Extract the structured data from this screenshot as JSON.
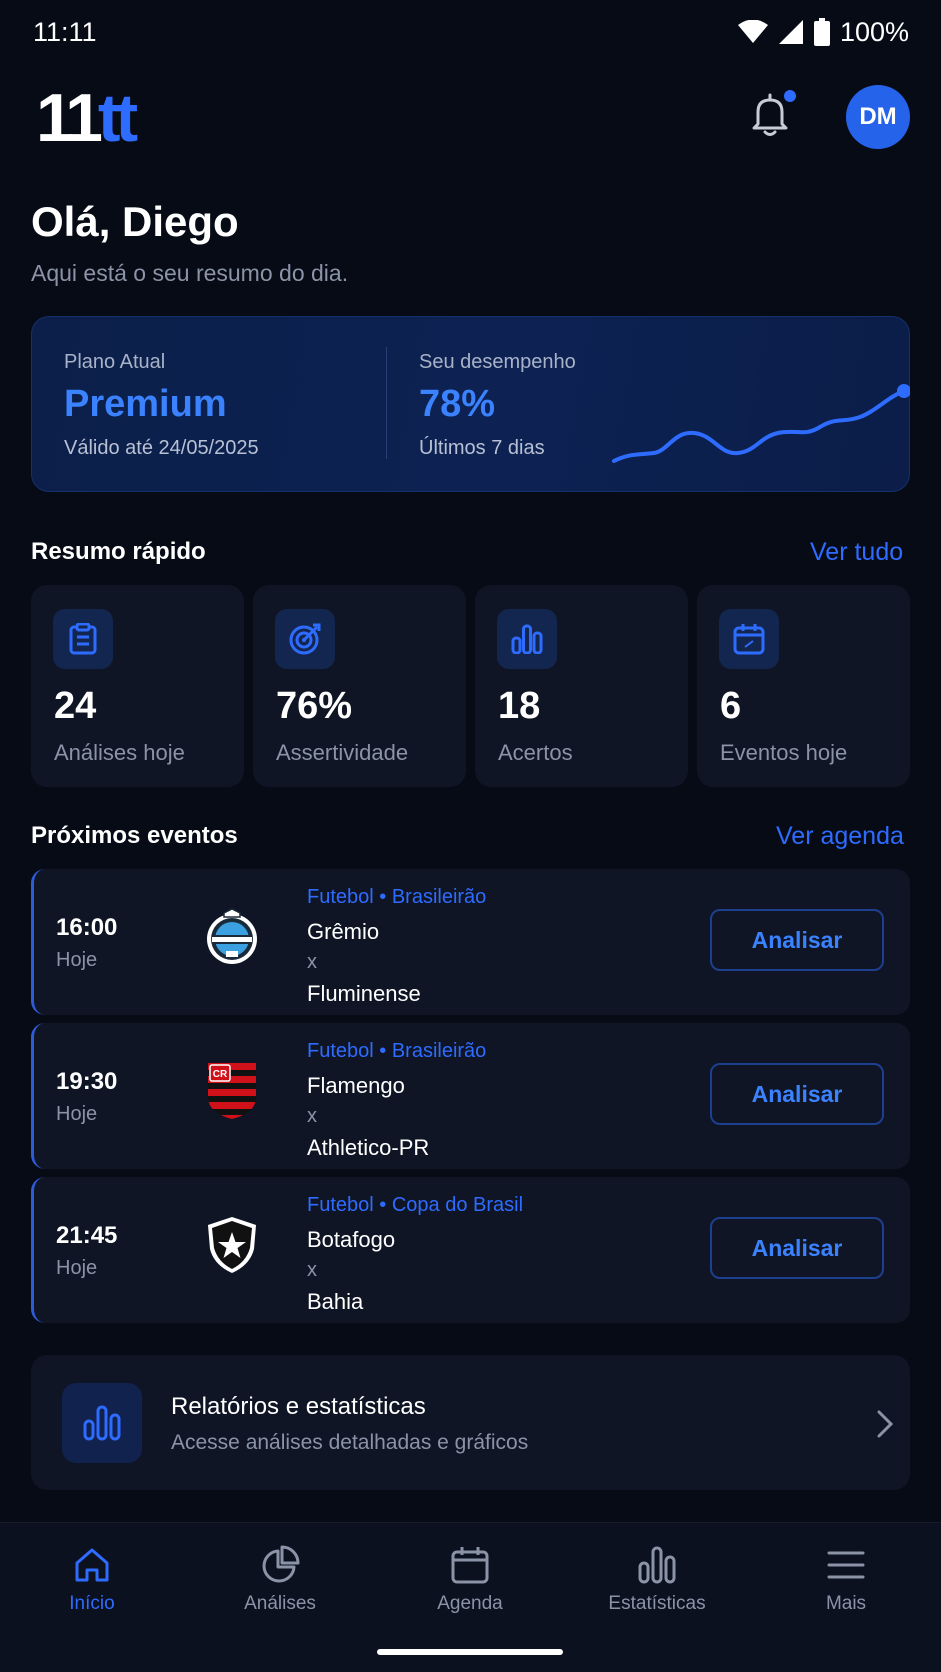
{
  "status": {
    "time": "11:11",
    "battery": "100%"
  },
  "header": {
    "logo_part1": "11",
    "logo_part2": "tt",
    "avatar_initials": "DM"
  },
  "greeting": {
    "title": "Olá, Diego",
    "subtitle": "Aqui está o seu resumo do dia."
  },
  "plan": {
    "label": "Plano Atual",
    "name": "Premium",
    "valid": "Válido até 24/05/2025",
    "perf_label": "Seu desempenho",
    "perf_value": "78%",
    "perf_period": "Últimos 7 dias"
  },
  "summary": {
    "title": "Resumo rápido",
    "link": "Ver tudo",
    "stats": [
      {
        "value": "24",
        "label": "Análises hoje",
        "icon": "clipboard-icon"
      },
      {
        "value": "76%",
        "label": "Assertividade",
        "icon": "target-icon"
      },
      {
        "value": "18",
        "label": "Acertos",
        "icon": "bar-chart-icon"
      },
      {
        "value": "6",
        "label": "Eventos hoje",
        "icon": "calendar-icon"
      }
    ]
  },
  "events": {
    "title": "Próximos eventos",
    "link": "Ver agenda",
    "items": [
      {
        "time": "16:00",
        "day": "Hoje",
        "league": "Futebol • Brasileirão",
        "team1": "Grêmio",
        "x": "x",
        "team2": "Fluminense",
        "button": "Analisar",
        "crest": "gremio-crest-icon"
      },
      {
        "time": "19:30",
        "day": "Hoje",
        "league": "Futebol • Brasileirão",
        "team1": "Flamengo",
        "x": "x",
        "team2": "Athletico-PR",
        "button": "Analisar",
        "crest": "flamengo-crest-icon"
      },
      {
        "time": "21:45",
        "day": "Hoje",
        "league": "Futebol • Copa do Brasil",
        "team1": "Botafogo",
        "x": "x",
        "team2": "Bahia",
        "button": "Analisar",
        "crest": "botafogo-crest-icon"
      }
    ]
  },
  "report": {
    "title": "Relatórios e estatísticas",
    "subtitle": "Acesse análises detalhadas e gráficos"
  },
  "nav": [
    {
      "label": "Início",
      "icon": "home-icon",
      "active": true
    },
    {
      "label": "Análises",
      "icon": "pie-chart-icon",
      "active": false
    },
    {
      "label": "Agenda",
      "icon": "calendar-icon",
      "active": false
    },
    {
      "label": "Estatísticas",
      "icon": "bar-chart-icon",
      "active": false
    },
    {
      "label": "Mais",
      "icon": "menu-icon",
      "active": false
    }
  ],
  "colors": {
    "accent": "#2e6bff",
    "background": "#070b16",
    "card": "#0f1524",
    "muted": "#8b93a7"
  }
}
